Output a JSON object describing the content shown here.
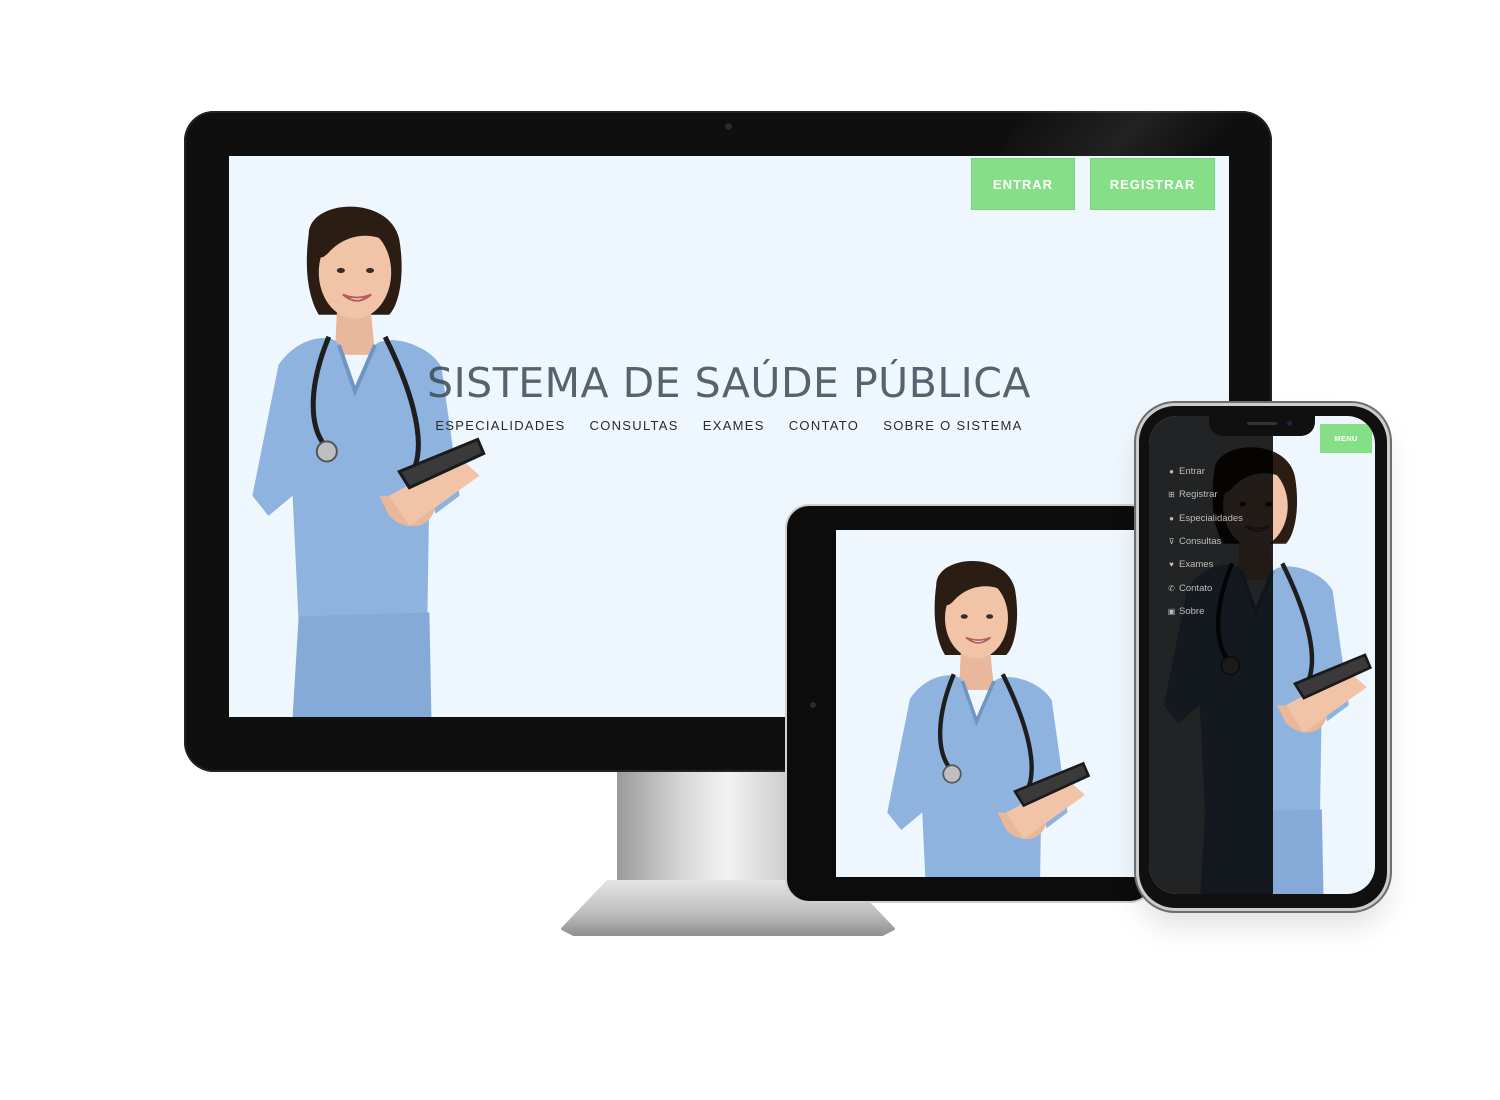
{
  "desktop": {
    "buttons": {
      "login": "ENTRAR",
      "register": "REGISTRAR"
    },
    "hero": {
      "title": "SISTEMA DE SAÚDE PÚBLICA",
      "nav": [
        "ESPECIALIDADES",
        "CONSULTAS",
        "EXAMES",
        "CONTATO",
        "SOBRE O SISTEMA"
      ]
    }
  },
  "phone": {
    "menu_button": "MENU",
    "drawer_items": [
      {
        "label": "Entrar",
        "icon": "user-icon"
      },
      {
        "label": "Registrar",
        "icon": "plus-square-icon"
      },
      {
        "label": "Especialidades",
        "icon": "users-icon"
      },
      {
        "label": "Consultas",
        "icon": "stethoscope-icon"
      },
      {
        "label": "Exames",
        "icon": "heartbeat-icon"
      },
      {
        "label": "Contato",
        "icon": "phone-icon"
      },
      {
        "label": "Sobre",
        "icon": "h-square-icon"
      }
    ]
  },
  "colors": {
    "accent": "#84df86",
    "screen_bg": "#eef6fe",
    "scrubs": "#8fb3df",
    "bezel": "#0f0f0f"
  }
}
